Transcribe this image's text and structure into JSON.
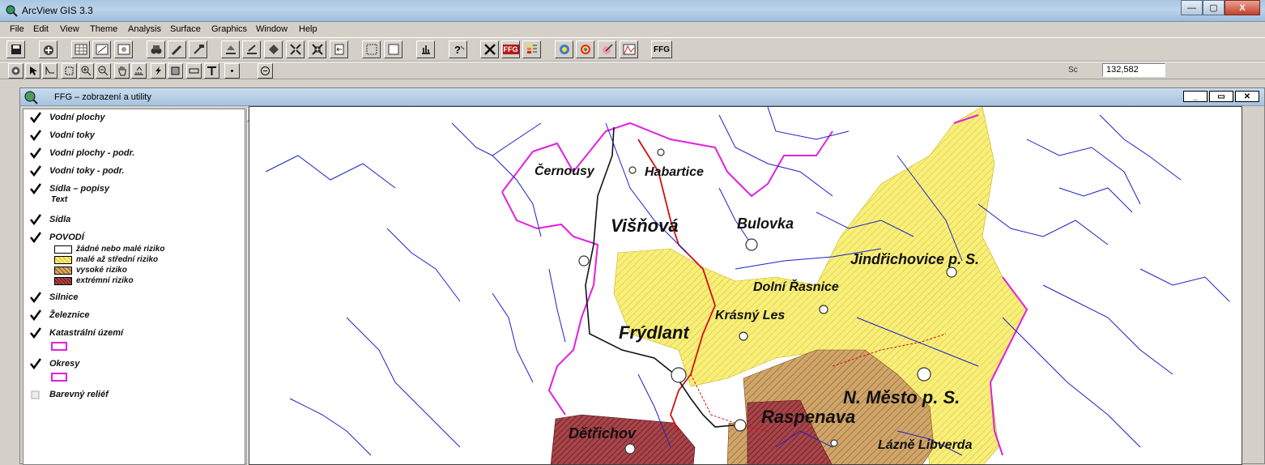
{
  "window": {
    "title": "ArcView GIS 3.3",
    "buttons": {
      "minimize": "—",
      "maximize": "▢",
      "close": "X"
    }
  },
  "menu": [
    "File",
    "Edit",
    "View",
    "Theme",
    "Analysis",
    "Surface",
    "Graphics",
    "Window",
    "Help"
  ],
  "toolbar": {
    "ffg_label": "FFG",
    "ffg2_label": "FFG",
    "scale_label": "Sc",
    "scale_value": "132,582"
  },
  "view": {
    "title": "FFG – zobrazení a utility",
    "toc": {
      "layers": [
        {
          "name": "Vodní plochy",
          "checked": true
        },
        {
          "name": "Vodní toky",
          "checked": true
        },
        {
          "name": "Vodní plochy - podr.",
          "checked": true
        },
        {
          "name": "Vodní toky - podr.",
          "checked": true
        },
        {
          "name": "Sídla – popisy",
          "checked": true,
          "sub": "Text"
        },
        {
          "name": "Sídla",
          "checked": true
        },
        {
          "name": "POVODÍ",
          "checked": true
        },
        {
          "name": "Silnice",
          "checked": true
        },
        {
          "name": "Železnice",
          "checked": true
        },
        {
          "name": "Katastrální území",
          "checked": true
        },
        {
          "name": "Okresy",
          "checked": true
        },
        {
          "name": "Barevný reliéf",
          "checked": false
        }
      ],
      "povodi_legend": [
        {
          "label": "žádné nebo malé riziko",
          "color": "#ffffff"
        },
        {
          "label": "malé až střední riziko",
          "color": "#f7ef7a"
        },
        {
          "label": "vysoké riziko",
          "color": "#d9a861"
        },
        {
          "label": "extrémní riziko",
          "color": "#b7474a"
        }
      ]
    },
    "map": {
      "places": [
        "Černousy",
        "Habartice",
        "Višňová",
        "Bulovka",
        "Jindřichovice p. S.",
        "Dolní Řasnice",
        "Krásný Les",
        "Frýdlant",
        "N. Město p. S.",
        "Raspenava",
        "Dětřichov",
        "Lázně Libverda"
      ]
    }
  },
  "colors": {
    "water": "#1a22c8",
    "yellow_zone": "#f7ef7a",
    "brown_zone": "#cfa56a",
    "red_zone": "#a8454a",
    "boundary": "#e020e0",
    "road": "#d01010"
  }
}
